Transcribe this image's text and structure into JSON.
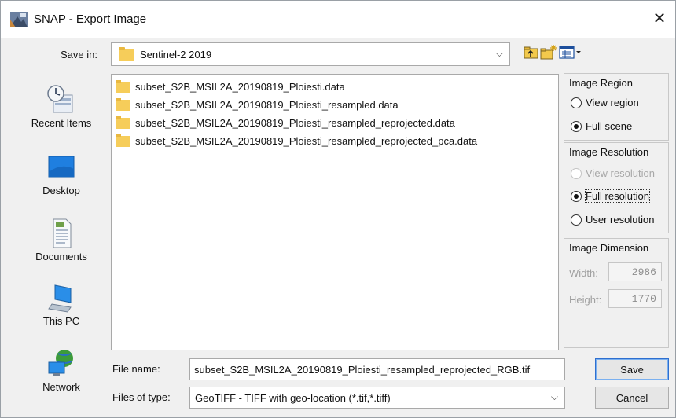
{
  "window": {
    "title": "SNAP - Export Image",
    "close_glyph": "✕"
  },
  "save_in": {
    "label": "Save in:",
    "value": "Sentinel-2 2019",
    "arrow_glyph": "⌵"
  },
  "toolbar": {
    "icons": [
      "up-one-level-icon",
      "create-new-folder-icon",
      "view-menu-icon"
    ]
  },
  "places": [
    {
      "label": "Recent Items",
      "icon": "recent-items-icon"
    },
    {
      "label": "Desktop",
      "icon": "desktop-icon"
    },
    {
      "label": "Documents",
      "icon": "documents-icon"
    },
    {
      "label": "This PC",
      "icon": "this-pc-icon"
    },
    {
      "label": "Network",
      "icon": "network-icon"
    }
  ],
  "files": [
    "subset_S2B_MSIL2A_20190819_Ploiesti.data",
    "subset_S2B_MSIL2A_20190819_Ploiesti_resampled.data",
    "subset_S2B_MSIL2A_20190819_Ploiesti_resampled_reprojected.data",
    "subset_S2B_MSIL2A_20190819_Ploiesti_resampled_reprojected_pca.data"
  ],
  "image_region": {
    "title": "Image Region",
    "options": [
      {
        "label": "View region",
        "checked": false,
        "enabled": true
      },
      {
        "label": "Full scene",
        "checked": true,
        "enabled": true
      }
    ]
  },
  "image_resolution": {
    "title": "Image Resolution",
    "options": [
      {
        "label": "View resolution",
        "checked": false,
        "enabled": false
      },
      {
        "label": "Full resolution",
        "checked": true,
        "enabled": true
      },
      {
        "label": "User resolution",
        "checked": false,
        "enabled": true
      }
    ]
  },
  "image_dimension": {
    "title": "Image Dimension",
    "width_label": "Width:",
    "width_value": "2986",
    "height_label": "Height:",
    "height_value": "1770"
  },
  "file_name": {
    "label": "File name:",
    "value": "subset_S2B_MSIL2A_20190819_Ploiesti_resampled_reprojected_RGB.tif"
  },
  "file_type": {
    "label": "Files of type:",
    "value": "GeoTIFF - TIFF with geo-location (*.tif,*.tiff)",
    "arrow_glyph": "⌵"
  },
  "buttons": {
    "save": "Save",
    "cancel": "Cancel"
  },
  "colors": {
    "folder": "#f6cd5a",
    "accent": "#2f6fcf"
  }
}
